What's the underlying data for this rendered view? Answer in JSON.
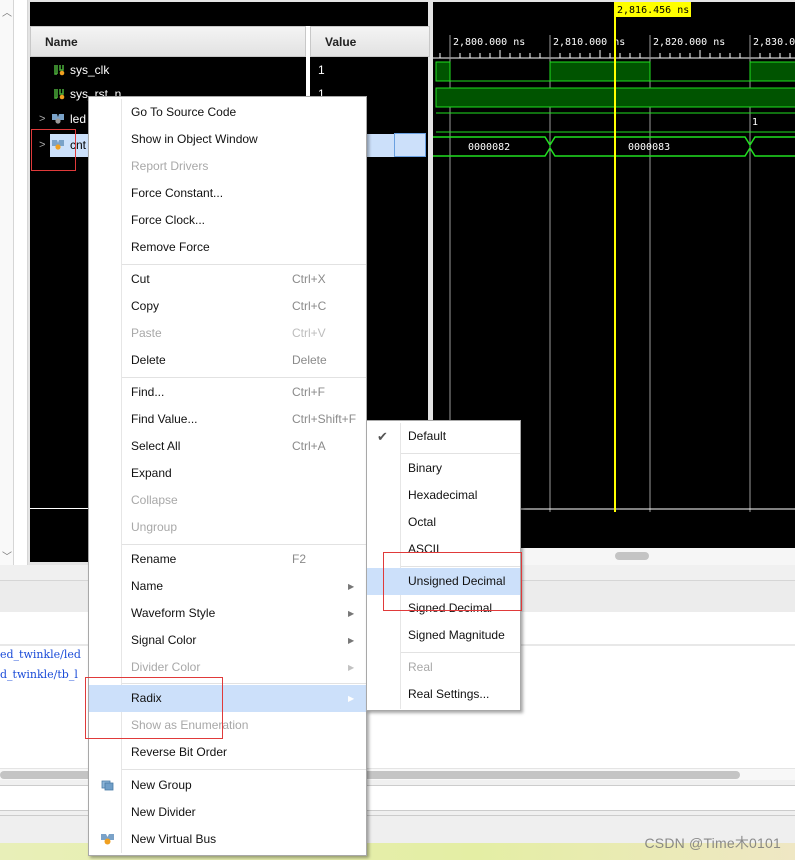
{
  "signals_panel": {
    "columns": {
      "name": "Name",
      "value": "Value"
    },
    "signals": [
      {
        "name": "sys_clk",
        "value": "1",
        "icon": "logic-signal-icon",
        "expandable": false
      },
      {
        "name": "sys_rst_n",
        "value": "1",
        "icon": "logic-signal-icon",
        "expandable": false
      },
      {
        "name": "led",
        "value": "",
        "icon": "bus-signal-icon",
        "expandable": true
      },
      {
        "name": "cnt",
        "value": "",
        "icon": "bus-signal-icon",
        "expandable": true,
        "selected": true
      }
    ],
    "expander_glyph": ">"
  },
  "waveform": {
    "cursor_label": "2,816.456 ns",
    "time_ticks": [
      "2,800.000 ns",
      "2,810.000 ns",
      "2,820.000 ns",
      "2,830.0"
    ],
    "led_value_label": "1",
    "cnt_values": [
      "0000082",
      "0000083"
    ],
    "colors": {
      "signal": "#20e020",
      "fill": "#005400",
      "cursor": "#ffff00",
      "grid": "#9a9a9a"
    }
  },
  "console": {
    "lines": [
      "ed_twinkle/led",
      "d_twinkle/tb_l"
    ]
  },
  "context_menu": {
    "items": [
      {
        "label": "Go To Source Code",
        "shortcut": "",
        "disabled": false
      },
      {
        "label": "Show in Object Window",
        "shortcut": "",
        "disabled": false
      },
      {
        "label": "Report Drivers",
        "shortcut": "",
        "disabled": true
      },
      {
        "label": "Force Constant...",
        "shortcut": "",
        "disabled": false
      },
      {
        "label": "Force Clock...",
        "shortcut": "",
        "disabled": false
      },
      {
        "label": "Remove Force",
        "shortcut": "",
        "disabled": false
      },
      {
        "label": "Cut",
        "shortcut": "Ctrl+X",
        "disabled": false
      },
      {
        "label": "Copy",
        "shortcut": "Ctrl+C",
        "disabled": false
      },
      {
        "label": "Paste",
        "shortcut": "Ctrl+V",
        "disabled": true
      },
      {
        "label": "Delete",
        "shortcut": "Delete",
        "disabled": false
      },
      {
        "label": "Find...",
        "shortcut": "Ctrl+F",
        "disabled": false
      },
      {
        "label": "Find Value...",
        "shortcut": "Ctrl+Shift+F",
        "disabled": false
      },
      {
        "label": "Select All",
        "shortcut": "Ctrl+A",
        "disabled": false
      },
      {
        "label": "Expand",
        "shortcut": "",
        "disabled": false
      },
      {
        "label": "Collapse",
        "shortcut": "",
        "disabled": true
      },
      {
        "label": "Ungroup",
        "shortcut": "",
        "disabled": true
      },
      {
        "label": "Rename",
        "shortcut": "F2",
        "disabled": false
      },
      {
        "label": "Name",
        "submenu": true,
        "disabled": false
      },
      {
        "label": "Waveform Style",
        "submenu": true,
        "disabled": false
      },
      {
        "label": "Signal Color",
        "submenu": true,
        "disabled": false
      },
      {
        "label": "Divider Color",
        "submenu": true,
        "disabled": true
      },
      {
        "label": "Radix",
        "submenu": true,
        "disabled": false,
        "highlighted": true
      },
      {
        "label": "Show as Enumeration",
        "disabled": true
      },
      {
        "label": "Reverse Bit Order",
        "disabled": false
      },
      {
        "label": "New Group",
        "icon": "new-group-icon",
        "disabled": false
      },
      {
        "label": "New Divider",
        "disabled": false
      },
      {
        "label": "New Virtual Bus",
        "icon": "virtual-bus-icon",
        "disabled": false
      }
    ],
    "arrow_glyph": "▶"
  },
  "radix_submenu": {
    "items": [
      {
        "label": "Default",
        "checked": true,
        "disabled": false
      },
      {
        "label": "Binary",
        "disabled": false
      },
      {
        "label": "Hexadecimal",
        "disabled": false
      },
      {
        "label": "Octal",
        "disabled": false
      },
      {
        "label": "ASCII",
        "disabled": false
      },
      {
        "label": "Unsigned Decimal",
        "disabled": false,
        "highlighted": true
      },
      {
        "label": "Signed Decimal",
        "disabled": false
      },
      {
        "label": "Signed Magnitude",
        "disabled": false
      },
      {
        "label": "Real",
        "disabled": true
      },
      {
        "label": "Real Settings...",
        "disabled": false
      }
    ],
    "check_glyph": "✔"
  },
  "watermark": "CSDN @Time木0101",
  "scroll_glyphs": {
    "up": "︿",
    "down": "﹀"
  }
}
